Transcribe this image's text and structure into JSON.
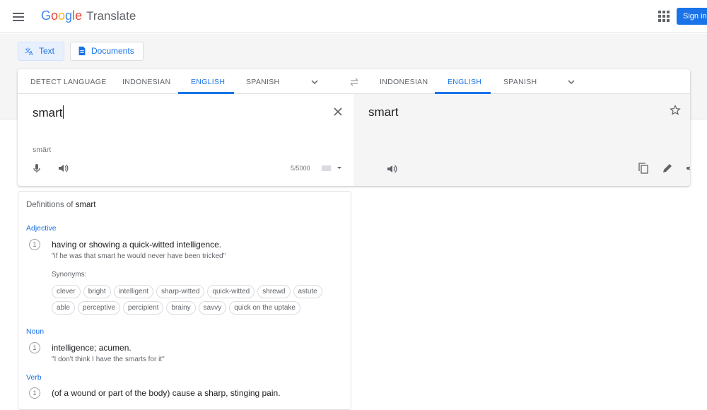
{
  "header": {
    "logo_letters": [
      "G",
      "o",
      "o",
      "g",
      "l",
      "e"
    ],
    "product": "Translate",
    "sign_in": "Sign in"
  },
  "modes": {
    "text": "Text",
    "documents": "Documents"
  },
  "source_langs": {
    "detect": "DETECT LANGUAGE",
    "l1": "INDONESIAN",
    "l2": "ENGLISH",
    "l3": "SPANISH",
    "selected": "ENGLISH"
  },
  "target_langs": {
    "l1": "INDONESIAN",
    "l2": "ENGLISH",
    "l3": "SPANISH",
    "selected": "ENGLISH"
  },
  "source": {
    "text": "smart",
    "transliteration": "smärt",
    "char_count": "5/5000"
  },
  "target": {
    "text": "smart"
  },
  "definitions": {
    "title_prefix": "Definitions of ",
    "word": "smart",
    "adjective": {
      "pos": "Adjective",
      "num": "1",
      "gloss": "having or showing a quick-witted intelligence.",
      "example": "\"if he was that smart he would never have been tricked\"",
      "synonyms_label": "Synonyms:",
      "synonyms": [
        "clever",
        "bright",
        "intelligent",
        "sharp-witted",
        "quick-witted",
        "shrewd",
        "astute",
        "able",
        "perceptive",
        "percipient",
        "brainy",
        "savvy",
        "quick on the uptake"
      ]
    },
    "noun": {
      "pos": "Noun",
      "num": "1",
      "gloss": "intelligence; acumen.",
      "example": "\"I don't think I have the smarts for it\""
    },
    "verb": {
      "pos": "Verb",
      "num": "1",
      "gloss": "(of a wound or part of the body) cause a sharp, stinging pain."
    }
  },
  "colors": {
    "accent": "#1a73e8",
    "target_bg": "#f5f5f5"
  }
}
